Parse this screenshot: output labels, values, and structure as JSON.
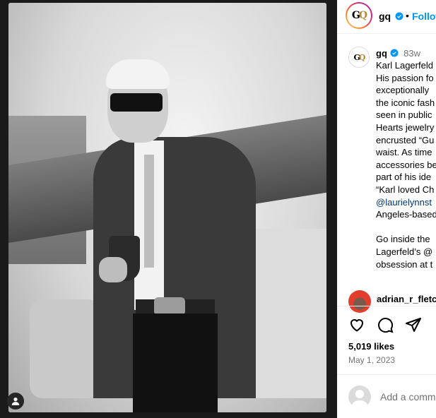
{
  "post": {
    "author": "gq",
    "follow_label": "Follow",
    "dot": "•",
    "age": "83w",
    "caption_lines": [
      "Karl Lagerfeld",
      "His passion fo",
      "exceptionally ",
      "the iconic fash",
      "seen in public",
      "Hearts jewelry",
      "encrusted “Gu",
      "waist. As time",
      "accessories be",
      "part of his ide",
      "“Karl loved Ch",
      "@laurielynnst",
      "Angeles-based",
      "",
      "Go inside the ",
      "Lagerfeld’s @",
      "obsession at t"
    ],
    "comment_user": "adrian_r_fletc",
    "likes": "5,019 likes",
    "date": "May 1, 2023",
    "add_comment_placeholder": "Add a comm"
  },
  "logo": {
    "g": "G",
    "q": "Q"
  },
  "colors": {
    "accent": "#0095f6",
    "verified": "#0095f6",
    "mention": "#00376b",
    "muted": "#737373"
  },
  "icons": [
    "heart-icon",
    "comment-icon",
    "share-icon",
    "verified-icon",
    "user-tag-icon"
  ]
}
